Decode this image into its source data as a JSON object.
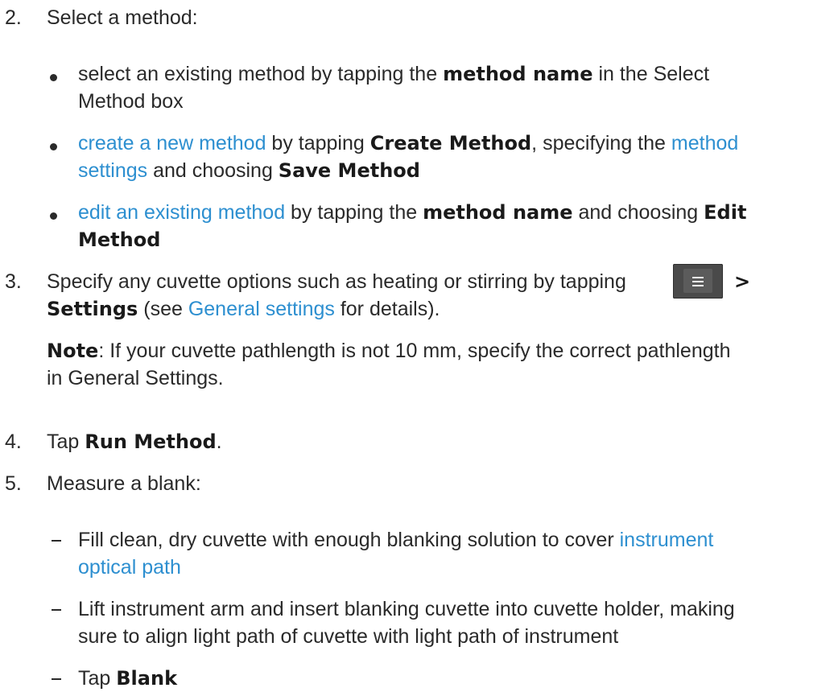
{
  "step2": {
    "number": "2.",
    "title": "Select a method:",
    "bullet1": {
      "part1": "select an existing method by tapping the ",
      "bold1": "method name",
      "part2": " in the Select",
      "line2": "Method box"
    },
    "bullet2": {
      "link1": "create a new method",
      "part1": " by tapping ",
      "bold1": "Create Method",
      "part2": ", specifying the ",
      "link2a": "method",
      "link2b": "settings",
      "part3": " and choosing ",
      "bold2": "Save Method"
    },
    "bullet3": {
      "link1": "edit an existing method",
      "part1": " by tapping the ",
      "bold1": "method name",
      "part2": " and choosing ",
      "bold2a": "Edit",
      "bold2b": "Method"
    }
  },
  "step3": {
    "number": "3.",
    "part1": "Specify any cuvette options such as heating or stirring by tapping",
    "menu_icon": "hamburger-menu-icon",
    "arrow": ">",
    "bold1": "Settings",
    "part2": " (see ",
    "link1": "General settings",
    "part3": " for details)."
  },
  "note": {
    "bold": "Note",
    "line1": ": If your cuvette pathlength is not 10 mm, specify the correct pathlength",
    "line2": "in General Settings."
  },
  "step4": {
    "number": "4.",
    "part1": "Tap ",
    "bold1": "Run Method",
    "part2": "."
  },
  "step5": {
    "number": "5.",
    "title": "Measure a blank:",
    "dash1": {
      "part1": "Fill clean, dry cuvette with enough blanking solution to cover ",
      "link1a": "instrument",
      "link1b": "optical path"
    },
    "dash2": {
      "line1": "Lift instrument arm and insert blanking cuvette into cuvette holder, making",
      "line2": "sure to align light path of cuvette with light path of instrument"
    },
    "dash3": {
      "part1": "Tap ",
      "bold1": "Blank"
    }
  },
  "colors": {
    "text": "#2a2a2a",
    "link": "#2d8fd0",
    "menu_button": "#4a4a4a"
  }
}
